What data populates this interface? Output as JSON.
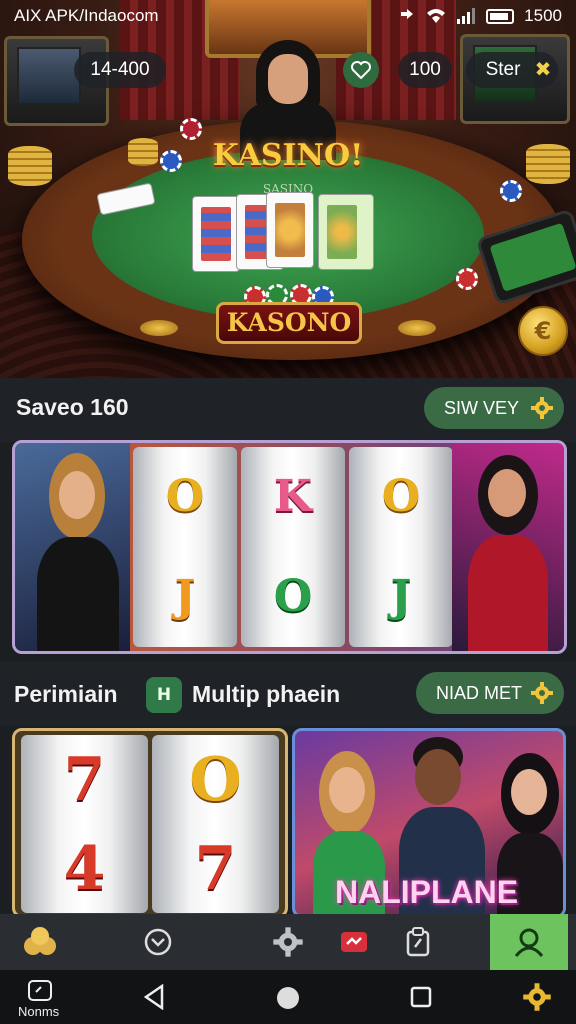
{
  "status_bar": {
    "carrier": "AIX APK/Indaocom",
    "battery": "1500"
  },
  "hud": {
    "coins": "14-400",
    "score": "100",
    "start_label": "Ster"
  },
  "hero": {
    "title_logo": "KASINO!",
    "table_text": "SASINO",
    "plaque": "KASONO"
  },
  "section1": {
    "title": "Saveo 160",
    "button": "SIW VEY",
    "reel_symbols": [
      [
        "O",
        "J"
      ],
      [
        "K",
        "O"
      ],
      [
        "O",
        "J"
      ]
    ]
  },
  "section2": {
    "title_left": "Perimiain",
    "chat_icon_text": "H",
    "title_right": "Multip phaein",
    "button": "NIAD MET",
    "reel_symbols": [
      [
        "7",
        "4"
      ],
      [
        "O",
        "7"
      ]
    ],
    "promo_text": "NALIPLANE"
  },
  "bottom_nav": [
    "home-icon",
    "chevron-circle-icon",
    "gear-icon",
    "gift-icon",
    "clipboard-icon",
    "profile-icon"
  ],
  "system_nav": {
    "left_label": "Nonms"
  },
  "colors": {
    "accent_green": "#3a6b45",
    "active_tab": "#6dc45e",
    "gold": "#f4c548"
  }
}
